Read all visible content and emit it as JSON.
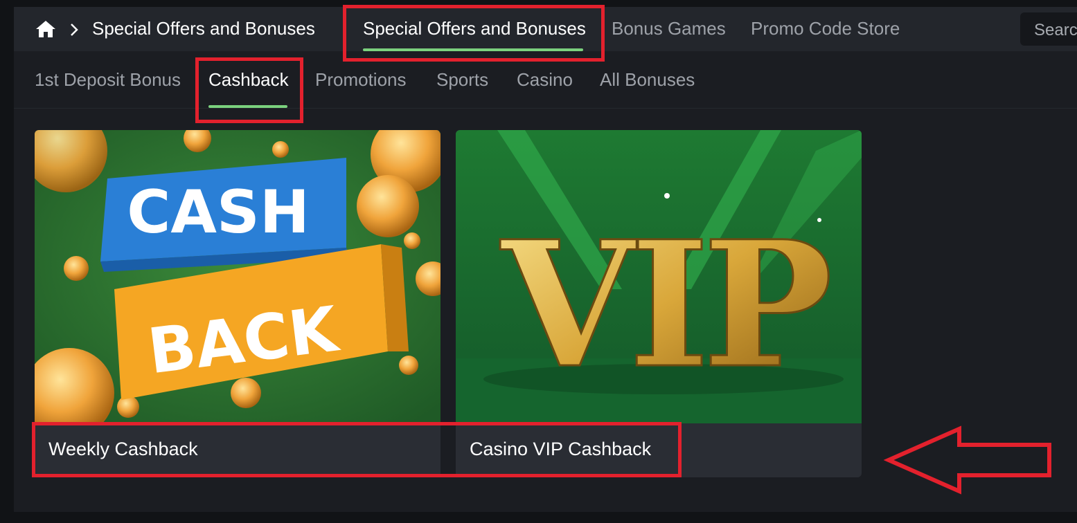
{
  "breadcrumb": {
    "home_icon": "home-icon",
    "separator_icon": "chevron-right-icon",
    "current": "Special Offers and Bonuses"
  },
  "top_tabs": [
    {
      "label": "Special Offers and Bonuses",
      "active": true
    },
    {
      "label": "Bonus Games",
      "active": false
    },
    {
      "label": "Promo Code Store",
      "active": false
    }
  ],
  "search": {
    "label": "Searc"
  },
  "sub_tabs": [
    {
      "label": "1st Deposit Bonus",
      "active": false
    },
    {
      "label": "Cashback",
      "active": true
    },
    {
      "label": "Promotions",
      "active": false
    },
    {
      "label": "Sports",
      "active": false
    },
    {
      "label": "Casino",
      "active": false
    },
    {
      "label": "All Bonuses",
      "active": false
    }
  ],
  "cards": [
    {
      "title": "Weekly Cashback",
      "image_text": [
        "CASH",
        "BACK"
      ]
    },
    {
      "title": "Casino VIP Cashback",
      "image_text": [
        "VIP"
      ]
    }
  ],
  "colors": {
    "accent": "#7bd17e",
    "highlight": "#e3212d",
    "background": "#1b1d22"
  }
}
